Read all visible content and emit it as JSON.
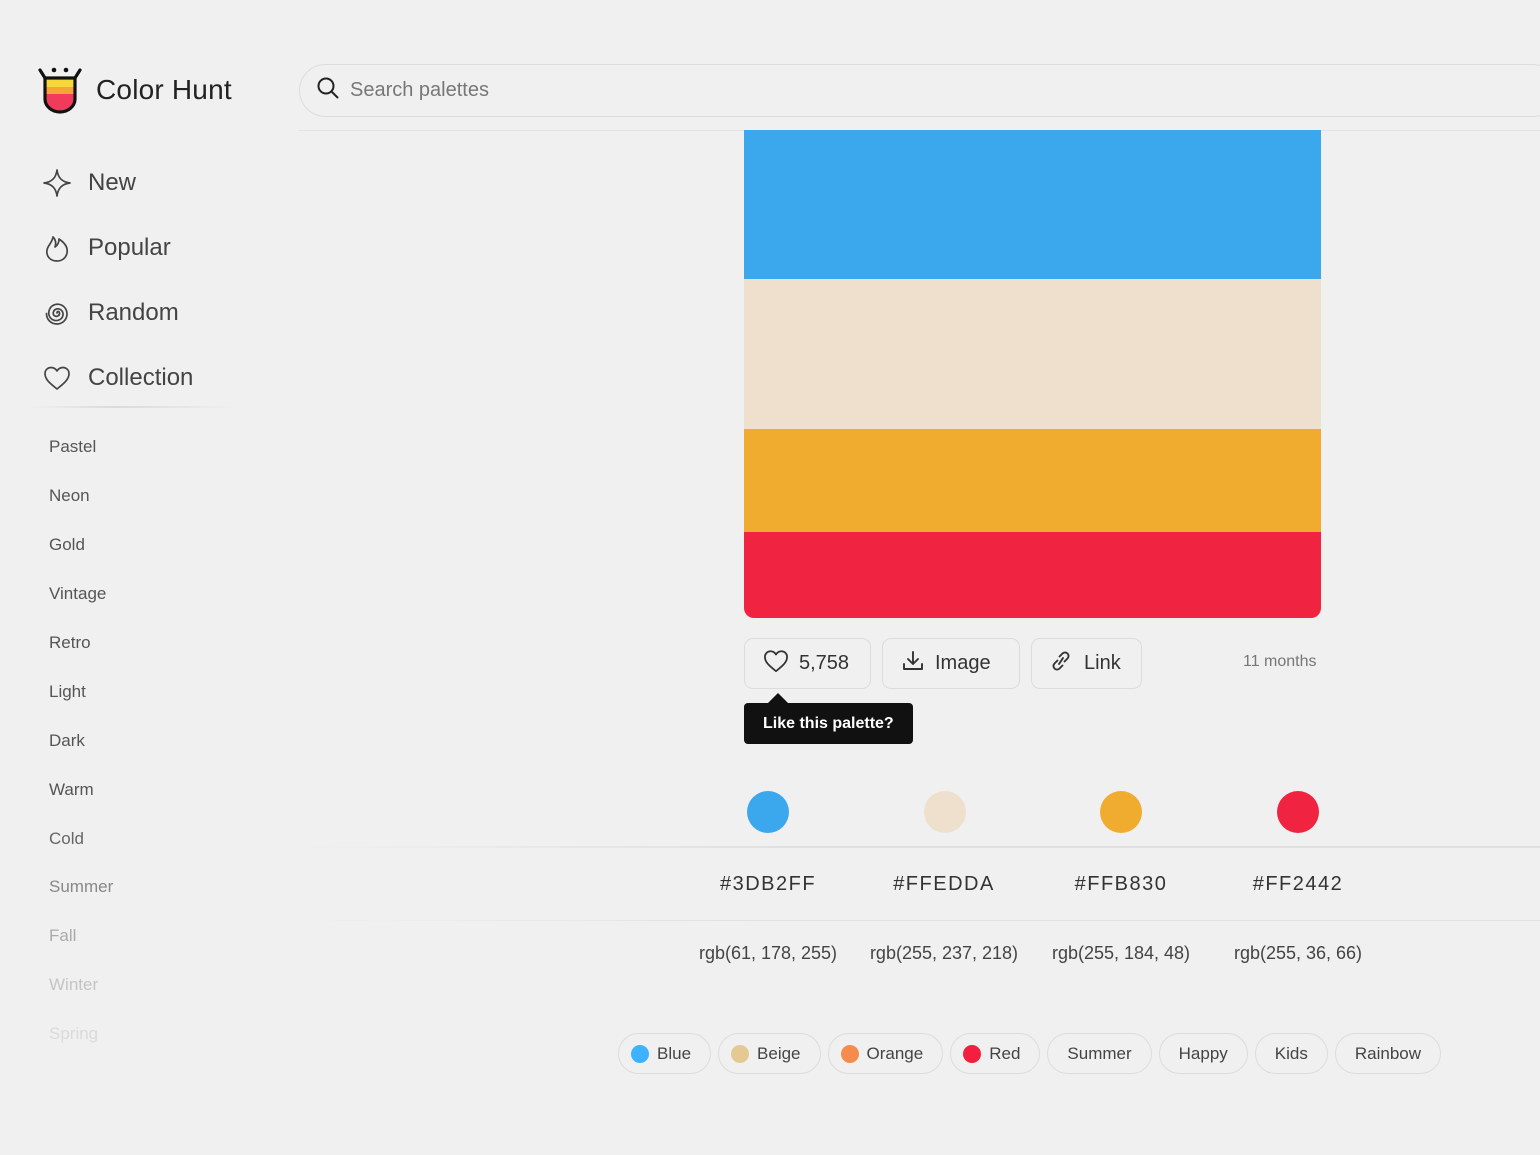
{
  "app": {
    "name": "Color Hunt"
  },
  "search": {
    "placeholder": "Search palettes",
    "value": ""
  },
  "nav": {
    "items": [
      {
        "label": "New",
        "icon": "sparkle-icon"
      },
      {
        "label": "Popular",
        "icon": "flame-icon"
      },
      {
        "label": "Random",
        "icon": "spiral-icon"
      },
      {
        "label": "Collection",
        "icon": "heart-icon"
      }
    ]
  },
  "tags": [
    "Pastel",
    "Neon",
    "Gold",
    "Vintage",
    "Retro",
    "Light",
    "Dark",
    "Warm",
    "Cold",
    "Summer",
    "Fall",
    "Winter",
    "Spring"
  ],
  "palette": {
    "colors": [
      {
        "hex": "#3DB2FF",
        "rgb": "rgb(61, 178, 255)"
      },
      {
        "hex": "#FFEDDA",
        "rgb": "rgb(255, 237, 218)"
      },
      {
        "hex": "#FFB830",
        "rgb": "rgb(255, 184, 48)"
      },
      {
        "hex": "#FF2442",
        "rgb": "rgb(255, 36, 66)"
      }
    ],
    "likes": "5,758",
    "image_label": "Image",
    "link_label": "Link",
    "age": "11 months",
    "tooltip": "Like this palette?"
  },
  "palette_tags": [
    {
      "label": "Blue",
      "dot": "#3DB2FF"
    },
    {
      "label": "Beige",
      "dot": "#E5C993"
    },
    {
      "label": "Orange",
      "dot": "#F58B4C"
    },
    {
      "label": "Red",
      "dot": "#F2203E"
    },
    {
      "label": "Summer"
    },
    {
      "label": "Happy"
    },
    {
      "label": "Kids"
    },
    {
      "label": "Rainbow"
    }
  ]
}
